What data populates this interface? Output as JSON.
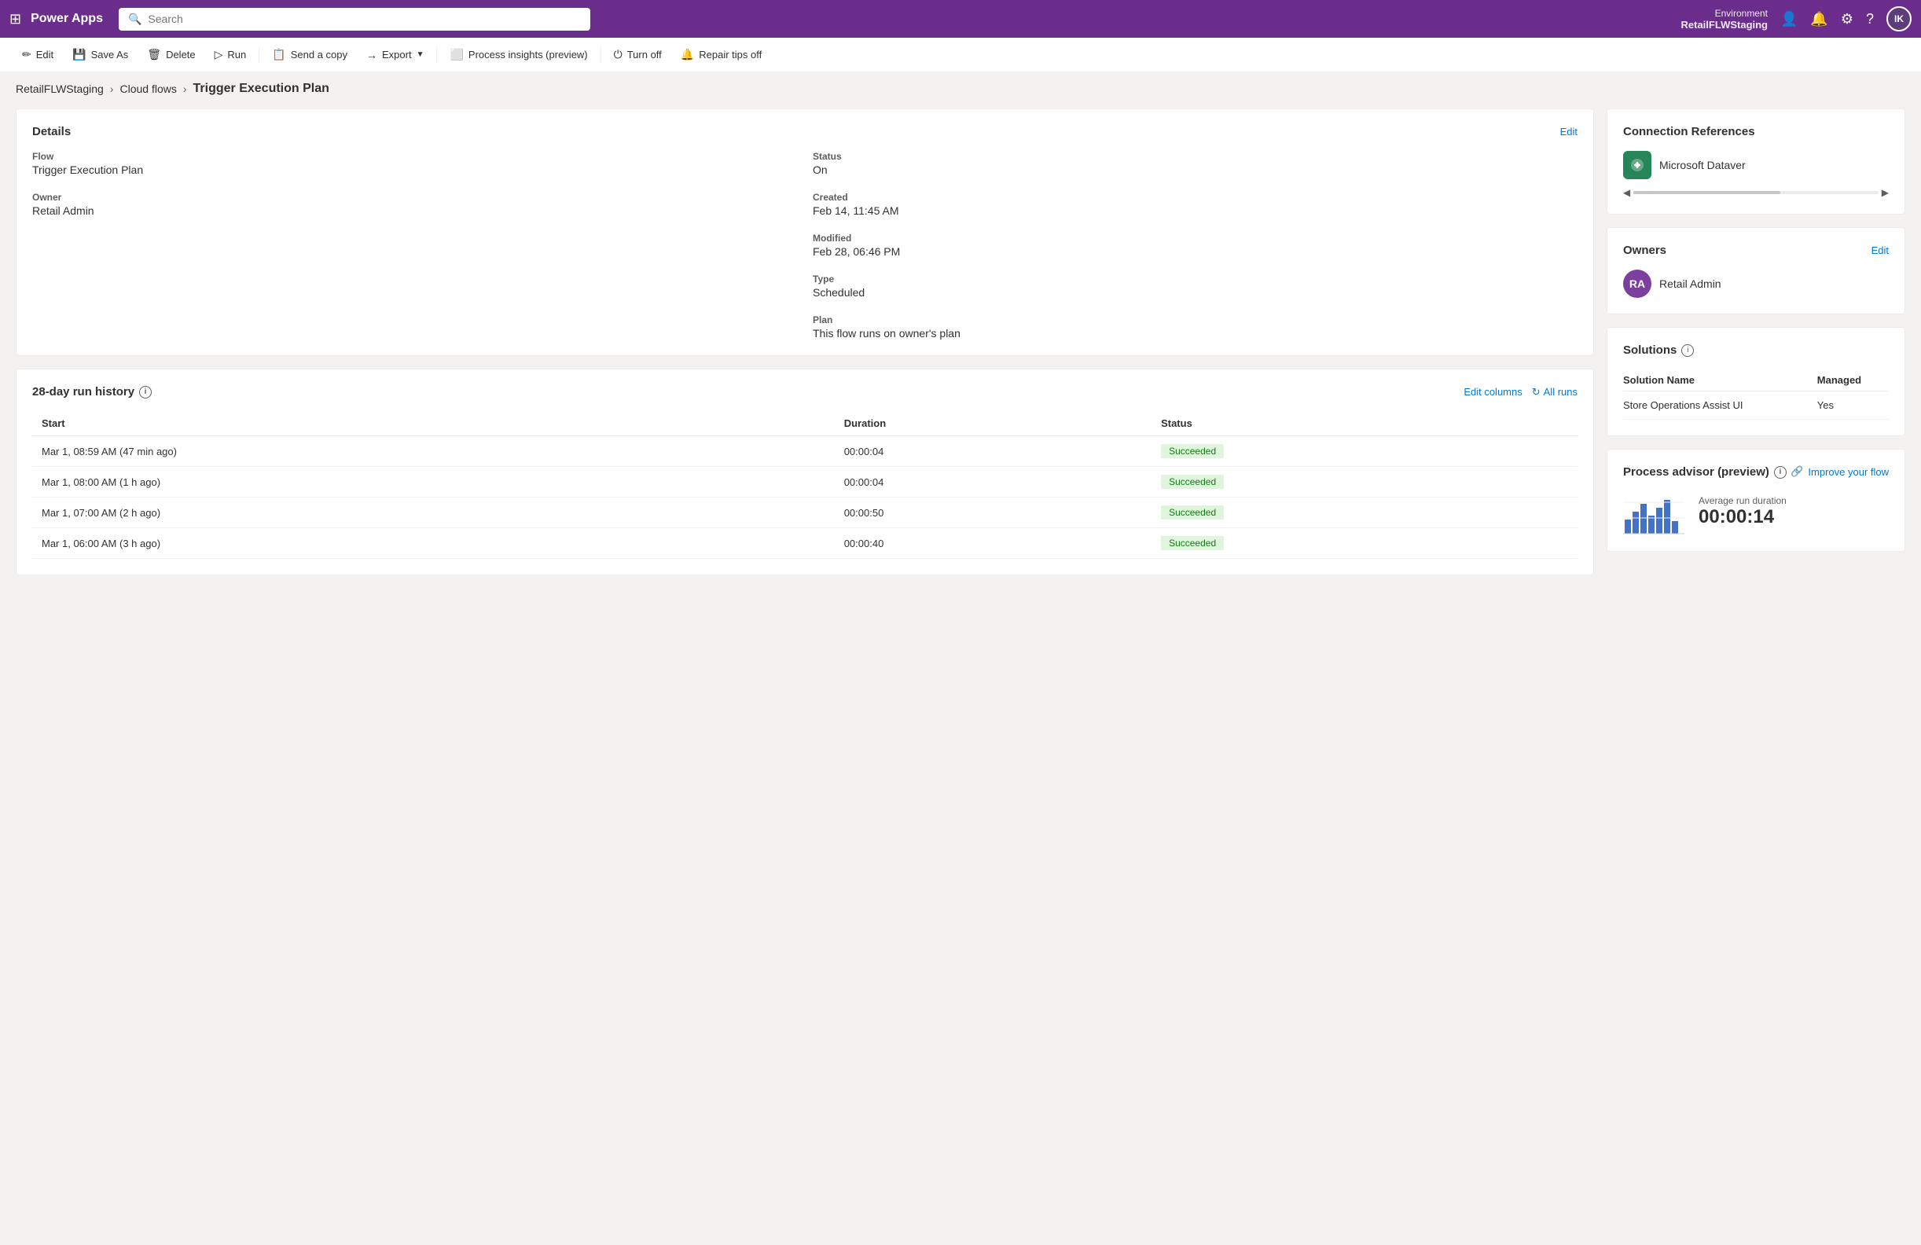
{
  "nav": {
    "app_name": "Power Apps",
    "search_placeholder": "Search",
    "environment_label": "Environment",
    "environment_name": "RetailFLWStaging",
    "avatar_initials": "IK"
  },
  "toolbar": {
    "edit_label": "Edit",
    "save_as_label": "Save As",
    "delete_label": "Delete",
    "run_label": "Run",
    "send_copy_label": "Send a copy",
    "export_label": "Export",
    "process_insights_label": "Process insights (preview)",
    "turn_off_label": "Turn off",
    "repair_tips_label": "Repair tips off"
  },
  "breadcrumb": {
    "env": "RetailFLWStaging",
    "flows": "Cloud flows",
    "current": "Trigger Execution Plan"
  },
  "details": {
    "title": "Details",
    "edit_label": "Edit",
    "flow_label": "Flow",
    "flow_value": "Trigger Execution Plan",
    "owner_label": "Owner",
    "owner_value": "Retail Admin",
    "status_label": "Status",
    "status_value": "On",
    "created_label": "Created",
    "created_value": "Feb 14, 11:45 AM",
    "modified_label": "Modified",
    "modified_value": "Feb 28, 06:46 PM",
    "type_label": "Type",
    "type_value": "Scheduled",
    "plan_label": "Plan",
    "plan_value": "This flow runs on owner's plan"
  },
  "run_history": {
    "title": "28-day run history",
    "edit_columns_label": "Edit columns",
    "all_runs_label": "All runs",
    "columns": [
      "Start",
      "Duration",
      "Status"
    ],
    "rows": [
      {
        "start": "Mar 1, 08:59 AM (47 min ago)",
        "duration": "00:00:04",
        "status": "Succeeded"
      },
      {
        "start": "Mar 1, 08:00 AM (1 h ago)",
        "duration": "00:00:04",
        "status": "Succeeded"
      },
      {
        "start": "Mar 1, 07:00 AM (2 h ago)",
        "duration": "00:00:50",
        "status": "Succeeded"
      },
      {
        "start": "Mar 1, 06:00 AM (3 h ago)",
        "duration": "00:00:40",
        "status": "Succeeded"
      }
    ]
  },
  "connection_references": {
    "title": "Connection References",
    "connector_name": "Microsoft Dataver"
  },
  "owners": {
    "title": "Owners",
    "edit_label": "Edit",
    "items": [
      {
        "initials": "RA",
        "name": "Retail Admin"
      }
    ]
  },
  "solutions": {
    "title": "Solutions",
    "info_icon": "ℹ",
    "col_name": "Solution Name",
    "col_managed": "Managed",
    "items": [
      {
        "name": "Store Operations Assist UI",
        "managed": "Yes"
      }
    ]
  },
  "process_advisor": {
    "title": "Process advisor (preview)",
    "info_icon": "ℹ",
    "improve_label": "Improve your flow",
    "avg_label": "Average run duration",
    "avg_value": "00:00:14"
  }
}
